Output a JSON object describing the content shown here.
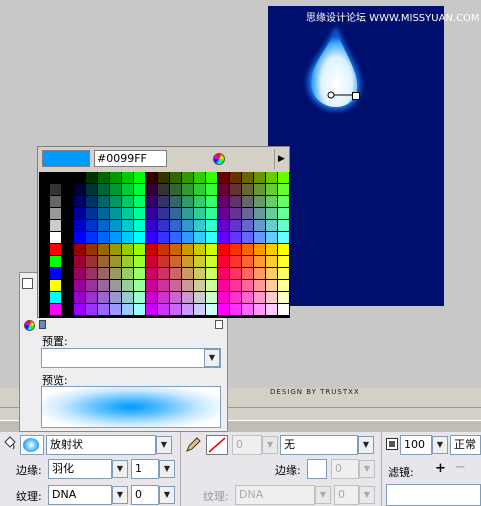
{
  "stage": {
    "watermark": "思缘设计论坛 WWW.MISSYUAN.COM",
    "credit": "DESIGN BY TRUSTXX",
    "canvas_color": "#000e6e"
  },
  "swatches": {
    "current_color": "#0099ff",
    "hex_value": "#0099FF"
  },
  "gradient_panel": {
    "preset_label": "预置:",
    "preset_value": "",
    "preview_label": "预览:"
  },
  "property_bar": {
    "fill_type": "放射状",
    "stroke_style": "无",
    "stroke_num": "0",
    "opacity": "100",
    "blend": "正常",
    "edge_label": "边缘:",
    "edge_value": "羽化",
    "edge_num": "1",
    "texture_label": "纹理:",
    "texture_value": "DNA",
    "texture_num": "0",
    "edge2_label": "边缘:",
    "edge2_num": "0",
    "texture2_label": "纹理:",
    "texture2_value": "DNA",
    "texture2_num": "0",
    "filter_label": "滤镜:",
    "add_symbol": "+",
    "remove_symbol": "−"
  }
}
